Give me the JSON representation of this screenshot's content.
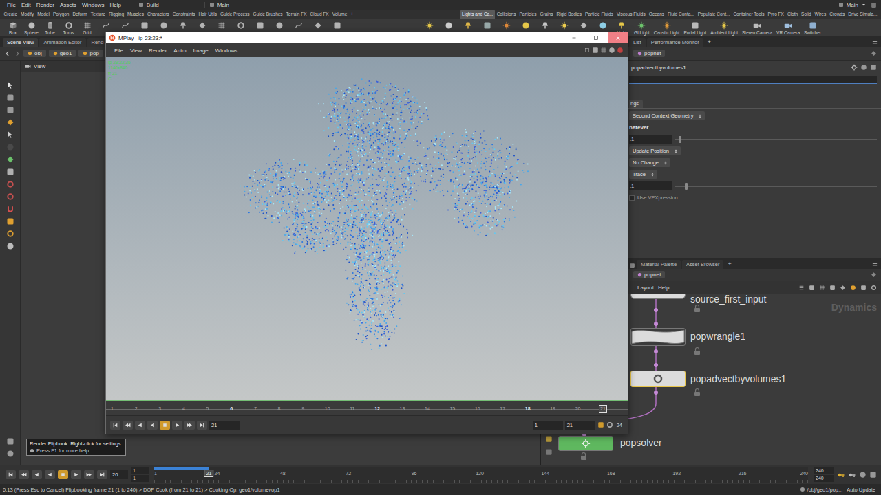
{
  "menu_bar": {
    "items": [
      "File",
      "Edit",
      "Render",
      "Assets",
      "Windows",
      "Help"
    ],
    "desktop": "Build",
    "context": "Main",
    "right_context": "Main"
  },
  "shelf_tabs_left": [
    {
      "label": "Create",
      "selected": false
    },
    {
      "label": "Modify",
      "selected": false
    },
    {
      "label": "Model",
      "selected": false
    },
    {
      "label": "Polygon",
      "selected": false
    },
    {
      "label": "Deform",
      "selected": false
    },
    {
      "label": "Texture",
      "selected": false
    },
    {
      "label": "Rigging",
      "selected": false
    },
    {
      "label": "Muscles",
      "selected": false
    },
    {
      "label": "Characters",
      "selected": false
    },
    {
      "label": "Constraints",
      "selected": false
    },
    {
      "label": "Hair Utils",
      "selected": false
    },
    {
      "label": "Guide Process",
      "selected": false
    },
    {
      "label": "Guide Brushes",
      "selected": false
    },
    {
      "label": "Terrain FX",
      "selected": false
    },
    {
      "label": "Cloud FX",
      "selected": false
    },
    {
      "label": "Volume",
      "selected": false
    }
  ],
  "shelf_tabs_add": "+",
  "shelf_tabs_right": [
    {
      "label": "Lights and Ca...",
      "selected": true
    },
    {
      "label": "Collisions",
      "selected": false
    },
    {
      "label": "Particles",
      "selected": false
    },
    {
      "label": "Grains",
      "selected": false
    },
    {
      "label": "Rigid Bodies",
      "selected": false
    },
    {
      "label": "Particle Fluids",
      "selected": false
    },
    {
      "label": "Viscous Fluids",
      "selected": false
    },
    {
      "label": "Oceans",
      "selected": false
    },
    {
      "label": "Fluid Conta...",
      "selected": false
    },
    {
      "label": "Populate Cont...",
      "selected": false
    },
    {
      "label": "Container Tools",
      "selected": false
    },
    {
      "label": "Pyro FX",
      "selected": false
    },
    {
      "label": "Cloth",
      "selected": false
    },
    {
      "label": "Solid",
      "selected": false
    },
    {
      "label": "Wires",
      "selected": false
    },
    {
      "label": "Crowds",
      "selected": false
    },
    {
      "label": "Drive Simula...",
      "selected": false
    }
  ],
  "shelf_tools_left": [
    "Box",
    "Sphere",
    "Tube",
    "Torus",
    "Grid"
  ],
  "shelf_tools_right": [
    "Light",
    "GI Light",
    "Caustic Light",
    "Portal Light",
    "Ambient Light",
    "Stereo Camera",
    "VR Camera",
    "Switcher"
  ],
  "scene_pane": {
    "tabs": [
      {
        "label": "Scene View",
        "selected": true
      },
      {
        "label": "Animation Editor",
        "selected": false
      },
      {
        "label": "Rend",
        "selected": false
      }
    ],
    "path": [
      "obj",
      "geo1",
      "pop"
    ],
    "viewport_label": "View"
  },
  "mplay": {
    "title": "MPlay - ip-23:23:*",
    "close_hovered": true,
    "menu": [
      "File",
      "View",
      "Render",
      "Anim",
      "Image",
      "Windows"
    ],
    "overlay": [
      "ip-23:23:36",
      "1140x840",
      "fr 21",
      "C"
    ],
    "ticks": [
      {
        "label": "1",
        "major": false
      },
      {
        "label": "2",
        "major": false
      },
      {
        "label": "3",
        "major": false
      },
      {
        "label": "4",
        "major": false
      },
      {
        "label": "5",
        "major": false
      },
      {
        "label": "6",
        "major": true
      },
      {
        "label": "7",
        "major": false
      },
      {
        "label": "8",
        "major": false
      },
      {
        "label": "9",
        "major": false
      },
      {
        "label": "10",
        "major": false
      },
      {
        "label": "11",
        "major": false
      },
      {
        "label": "12",
        "major": true
      },
      {
        "label": "13",
        "major": false
      },
      {
        "label": "14",
        "major": false
      },
      {
        "label": "15",
        "major": false
      },
      {
        "label": "16",
        "major": false
      },
      {
        "label": "17",
        "major": false
      },
      {
        "label": "18",
        "major": true
      },
      {
        "label": "19",
        "major": false
      },
      {
        "label": "20",
        "major": false
      },
      {
        "label": "21",
        "major": false
      }
    ],
    "current_frame": "21",
    "stop_active": true,
    "range_start": "1",
    "range_end": "21",
    "fps": "24"
  },
  "param_pane": {
    "tabs": [
      {
        "label": "List",
        "selected": false
      },
      {
        "label": "Performance Monitor",
        "selected": false
      }
    ],
    "add": "+",
    "path": "popnet",
    "node_name": "popadvectbyvolumes1",
    "folder_tab": "ngs",
    "params": [
      {
        "kind": "dropdown",
        "value": "Second Context Geometry"
      },
      {
        "kind": "text",
        "value": "hatever"
      },
      {
        "kind": "slider",
        "value": ".1",
        "level": 0.02
      },
      {
        "kind": "dropdown",
        "value": "Update Position"
      },
      {
        "kind": "dropdown",
        "value": "No Change"
      },
      {
        "kind": "dropdown",
        "value": "Trace"
      },
      {
        "kind": "slider",
        "value": ".1",
        "level": 0.05
      },
      {
        "kind": "checkbox",
        "label": "Use VEXpression",
        "checked": false
      }
    ]
  },
  "network_pane": {
    "tabs": [
      {
        "label": "Material Palette",
        "selected": false
      },
      {
        "label": "Asset Browser",
        "selected": false
      }
    ],
    "add": "+",
    "path": "popnet",
    "menu": [
      "Layout",
      "Help"
    ],
    "context_label": "Dynamics",
    "nodes": [
      {
        "name": "source_first_input",
        "kind": "source",
        "selected": false
      },
      {
        "name": "popwrangle1",
        "kind": "wrangle",
        "selected": false
      },
      {
        "name": "popadvectbyvolumes1",
        "kind": "advect",
        "selected": true
      },
      {
        "name": "popsolver",
        "kind": "solver",
        "selected": false
      }
    ]
  },
  "tooltip": {
    "title": "Render Flipbook. Right-click for settings.",
    "hint": "Press F1 for more help."
  },
  "timeline": {
    "frame": "20",
    "stop_active": true,
    "start": "1",
    "start_global": "1",
    "ticks": [
      "1",
      "24",
      "48",
      "72",
      "96",
      "120",
      "144",
      "168",
      "192",
      "216",
      "240"
    ],
    "current": "21",
    "cache_level": 0.084,
    "end": "240",
    "end_global": "240"
  },
  "status_bar": {
    "message": "0:13 (Press Esc to Cancel) Flipbooking frame 21 (1 to 240) > DOP Cook (from 21 to 21) > Cooking Op: geo1/volumevop1",
    "path": "/obj/geo1/pop...",
    "update_mode": "Auto Update"
  }
}
